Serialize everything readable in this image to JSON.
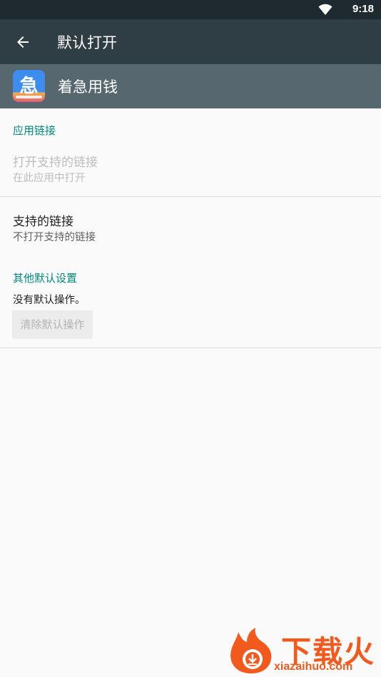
{
  "status_bar": {
    "time": "9:18",
    "wifi_icon": "wifi-icon"
  },
  "toolbar": {
    "title": "默认打开",
    "back_icon": "arrow-back-icon"
  },
  "app": {
    "name": "着急用钱",
    "icon_glyph": "急"
  },
  "app_links": {
    "section_title": "应用链接",
    "open_supported": {
      "title": "打开支持的链接",
      "summary": "在此应用中打开"
    }
  },
  "supported_links": {
    "title": "支持的链接",
    "summary": "不打开支持的链接"
  },
  "other_defaults": {
    "section_title": "其他默认设置",
    "no_defaults": "没有默认操作。",
    "clear_button": "清除默认操作"
  },
  "watermark": {
    "text": "下载火",
    "url": "xiazaihuo.com"
  },
  "colors": {
    "accent": "#00897b",
    "toolbar": "#2f3d45",
    "app_header": "#56676f",
    "watermark": "#f25a1d"
  }
}
